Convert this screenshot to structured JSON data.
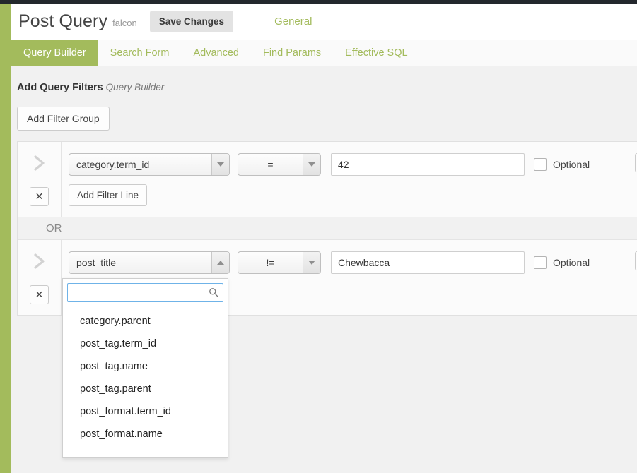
{
  "theme": {
    "accent_green": "#a3bb5c",
    "top_strip": "#23282d",
    "page_bg": "#f1f1f1",
    "focus_blue": "#6fb3e8"
  },
  "header": {
    "title": "Post Query",
    "subtitle": "falcon",
    "save_label": "Save Changes",
    "general_label": "General"
  },
  "tabs": [
    {
      "label": "Query Builder",
      "active": true
    },
    {
      "label": "Search Form",
      "active": false
    },
    {
      "label": "Advanced",
      "active": false
    },
    {
      "label": "Find Params",
      "active": false
    },
    {
      "label": "Effective SQL",
      "active": false
    }
  ],
  "section": {
    "title": "Add Query Filters",
    "subtitle": "Query Builder",
    "add_group_label": "Add Filter Group",
    "add_line_label": "Add Filter Line",
    "or_label": "OR",
    "remove_symbol": "✕",
    "chevron_symbol": "›"
  },
  "filters": [
    {
      "field": "category.term_id",
      "operator": "=",
      "value": "42",
      "optional_label": "Optional",
      "optional_checked": false,
      "expanded": false
    },
    {
      "field": "post_title",
      "operator": "!=",
      "value": "Chewbacca",
      "optional_label": "Optional",
      "optional_checked": false,
      "expanded": true
    }
  ],
  "dropdown": {
    "search_value": "",
    "search_placeholder": "",
    "options": [
      "category.parent",
      "post_tag.term_id",
      "post_tag.name",
      "post_tag.parent",
      "post_format.term_id",
      "post_format.name"
    ]
  }
}
